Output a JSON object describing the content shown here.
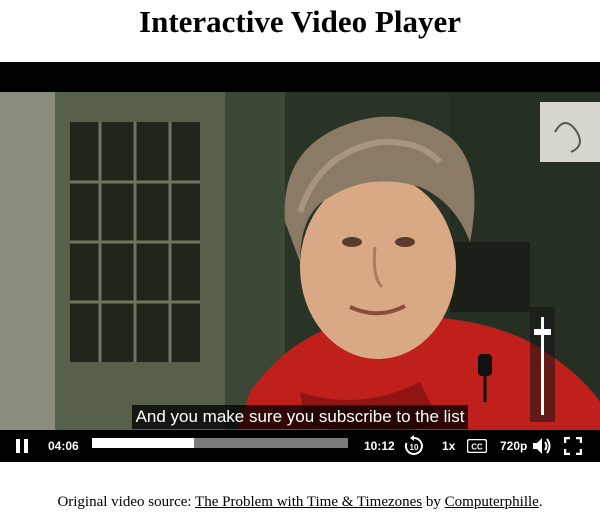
{
  "page": {
    "title": "Interactive Video Player"
  },
  "video": {
    "caption": "And you make sure you subscribe to the list"
  },
  "controls": {
    "play_state": "playing",
    "current_time": "04:06",
    "total_time": "10:12",
    "progress": 0.4,
    "skip_seconds": "10",
    "speed": "1x",
    "cc_label": "CC",
    "quality": "720p",
    "volume": 0.85
  },
  "footer": {
    "prefix": "Original video source: ",
    "video_link": "The Problem with Time & Timezones",
    "by": " by ",
    "channel_link": "Computerphille",
    "suffix": "."
  },
  "colors": {
    "shirt": "#c0201c",
    "player_bg": "#000000",
    "progress_track": "#7a7a7a",
    "progress_fill": "#ffffff"
  }
}
